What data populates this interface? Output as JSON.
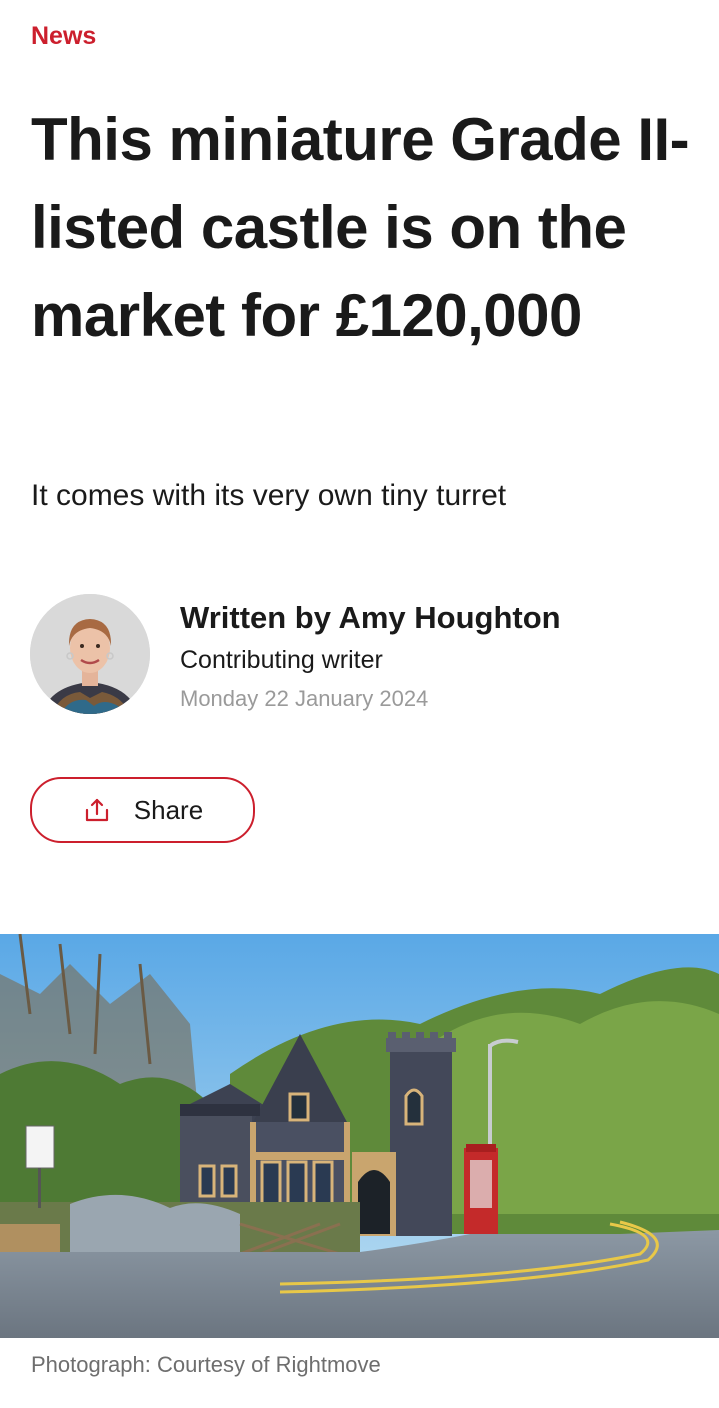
{
  "article": {
    "section": "News",
    "headline": "This miniature Grade II-listed castle is on the market for £120,000",
    "standfirst": "It comes with its very own tiny turret"
  },
  "byline": {
    "author": "Written by Amy Houghton",
    "role": "Contributing writer",
    "date": "Monday 22 January 2024",
    "avatar_icon": "author-portrait"
  },
  "share": {
    "label": "Share",
    "icon": "share-upload-icon"
  },
  "photo": {
    "caption": "Photograph: Courtesy of Rightmove"
  },
  "colors": {
    "accent": "#cc1f2d",
    "text": "#1a1a1a",
    "muted": "#9a9a9a",
    "caption": "#6e6e6e"
  }
}
